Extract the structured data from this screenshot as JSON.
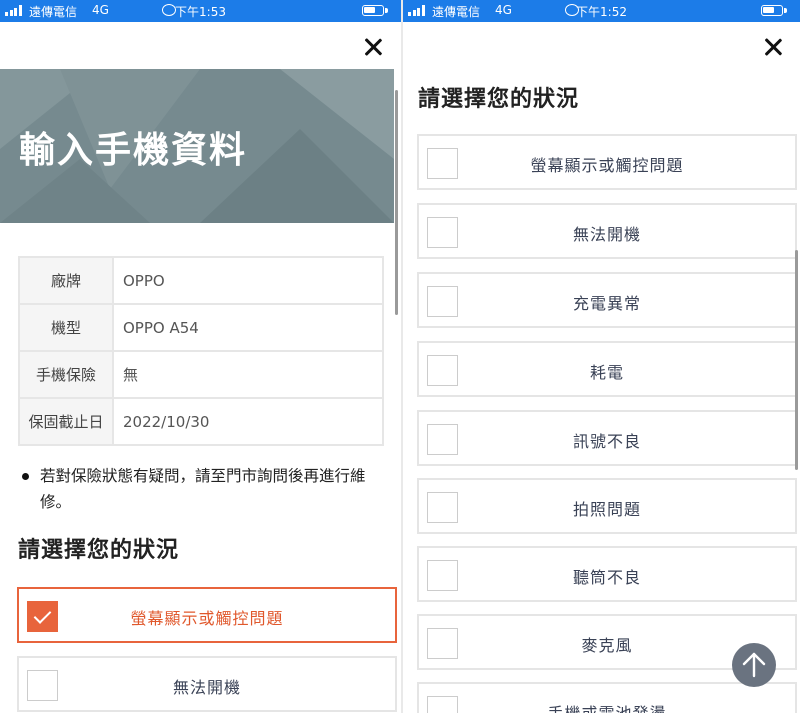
{
  "status_left": {
    "carrier": "遠傳電信",
    "network": "4G",
    "time": "下午1:53"
  },
  "status_right": {
    "carrier": "遠傳電信",
    "network": "4G",
    "time": "下午1:52"
  },
  "hero": {
    "title": "輸入手機資料"
  },
  "phone_info": [
    {
      "key": "廠牌",
      "value": "OPPO"
    },
    {
      "key": "機型",
      "value": "OPPO A54"
    },
    {
      "key": "手機保險",
      "value": "無"
    },
    {
      "key": "保固截止日",
      "value": "2022/10/30"
    }
  ],
  "note": "若對保險狀態有疑問，請至門市詢問後再進行維修。",
  "section_title": "請選擇您的狀況",
  "left_options": [
    {
      "label": "螢幕顯示或觸控問題",
      "checked": true
    },
    {
      "label": "無法開機",
      "checked": false
    }
  ],
  "right_options": [
    {
      "label": "螢幕顯示或觸控問題",
      "checked": false
    },
    {
      "label": "無法開機",
      "checked": false
    },
    {
      "label": "充電異常",
      "checked": false
    },
    {
      "label": "耗電",
      "checked": false
    },
    {
      "label": "訊號不良",
      "checked": false
    },
    {
      "label": "拍照問題",
      "checked": false
    },
    {
      "label": "聽筒不良",
      "checked": false
    },
    {
      "label": "麥克風",
      "checked": false
    },
    {
      "label": "手機或電池發燙",
      "checked": false
    }
  ],
  "colors": {
    "status_bar": "#1c7ce8",
    "accent_selected": "#e8643c",
    "hero_bg": "#768a8f",
    "scroll_top_button": "#6a7380"
  },
  "icons": {
    "close": "close-icon",
    "checkmark": "checkmark-icon",
    "scroll_top": "arrow-up-icon",
    "signal": "signal-icon",
    "battery": "battery-icon",
    "rotation_lock": "rotation-lock-icon"
  }
}
